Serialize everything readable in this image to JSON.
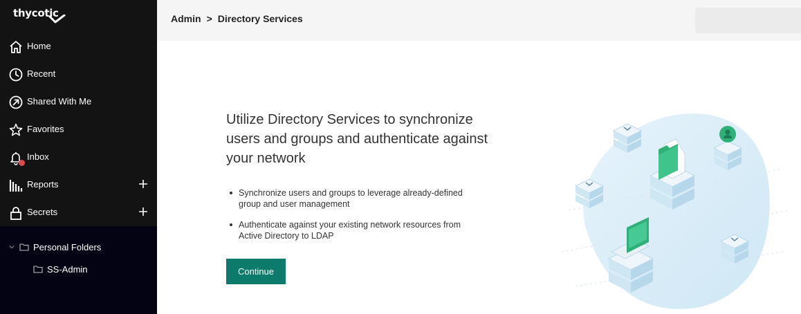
{
  "sidebar": {
    "logo": "thycotic",
    "nav": [
      {
        "label": "Home",
        "icon": "home-icon"
      },
      {
        "label": "Recent",
        "icon": "clock-icon"
      },
      {
        "label": "Shared With Me",
        "icon": "share-arrow-icon"
      },
      {
        "label": "Favorites",
        "icon": "star-icon"
      },
      {
        "label": "Inbox",
        "icon": "bell-icon",
        "has_notification": true
      },
      {
        "label": "Reports",
        "icon": "bar-chart-icon",
        "expandable": true
      },
      {
        "label": "Secrets",
        "icon": "lock-icon",
        "expandable": true
      }
    ],
    "folders": {
      "root": "Personal Folders",
      "children": [
        "SS-Admin"
      ]
    }
  },
  "header": {
    "breadcrumb": [
      "Admin",
      "Directory Services"
    ],
    "separator": ">"
  },
  "main": {
    "headline": "Utilize Directory Services to synchronize users and groups and authenticate against your network",
    "bullets": [
      "Synchronize users and groups to leverage already-defined group and user management",
      "Authenticate against your existing network resources from Active Directory to LDAP"
    ],
    "continue_label": "Continue"
  },
  "colors": {
    "sidebar_bg": "#131313",
    "folder_bg": "#030313",
    "accent": "#0c7b6b",
    "notification": "#e0484d",
    "illustration_green": "#2fb079",
    "illustration_blue": "#cfe7f5"
  }
}
